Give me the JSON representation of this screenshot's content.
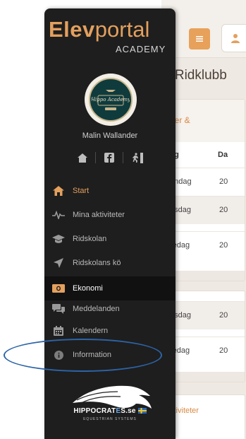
{
  "brand": {
    "name_bold": "Elev",
    "name_light": "portal",
    "subtitle": "ACADEMY"
  },
  "user": {
    "name": "Malin Wallander"
  },
  "logo": {
    "text": "Hippo Academy"
  },
  "quick_links": [
    {
      "icon": "home-icon"
    },
    {
      "icon": "facebook-icon"
    },
    {
      "icon": "exit-icon"
    }
  ],
  "nav": [
    {
      "label": "Start",
      "icon": "home-icon",
      "state": "active"
    },
    {
      "label": "Mina aktiviteter",
      "icon": "activity-pulse-icon",
      "state": ""
    },
    {
      "label": "Ridskolan",
      "icon": "graduation-cap-icon",
      "state": ""
    },
    {
      "label": "Ridskolans kö",
      "icon": "send-arrow-icon",
      "state": ""
    },
    {
      "label": "Ekonomi",
      "icon": "money-icon",
      "state": "current"
    },
    {
      "label": "Meddelanden",
      "icon": "chat-bubbles-icon",
      "state": ""
    },
    {
      "label": "Kalendern",
      "icon": "calendar-icon",
      "state": ""
    },
    {
      "label": "Information",
      "icon": "info-icon",
      "state": ""
    }
  ],
  "footer_logo": {
    "text_a": "HIPPOCRAT",
    "text_b": "E",
    "text_c": "S.se",
    "sub": "EQUESTRIAN SYSTEMS"
  },
  "main": {
    "title": "e Ridklubb",
    "card1": {
      "heading": "ner &",
      "col1": "ag",
      "col2": "Da",
      "rows": [
        {
          "day": "ändag",
          "date": "20"
        },
        {
          "day": "nsdag",
          "date": "20"
        },
        {
          "day": "redag",
          "date": "20"
        }
      ]
    },
    "card2": {
      "rows": [
        {
          "day": "nsdag",
          "date": "20"
        },
        {
          "day": "redag",
          "date": "20"
        }
      ]
    },
    "card3": {
      "heading": "ktiviteter"
    }
  },
  "colors": {
    "accent": "#e3a05e",
    "sidebar": "#1e1e1e",
    "highlight": "#2c64a8"
  }
}
